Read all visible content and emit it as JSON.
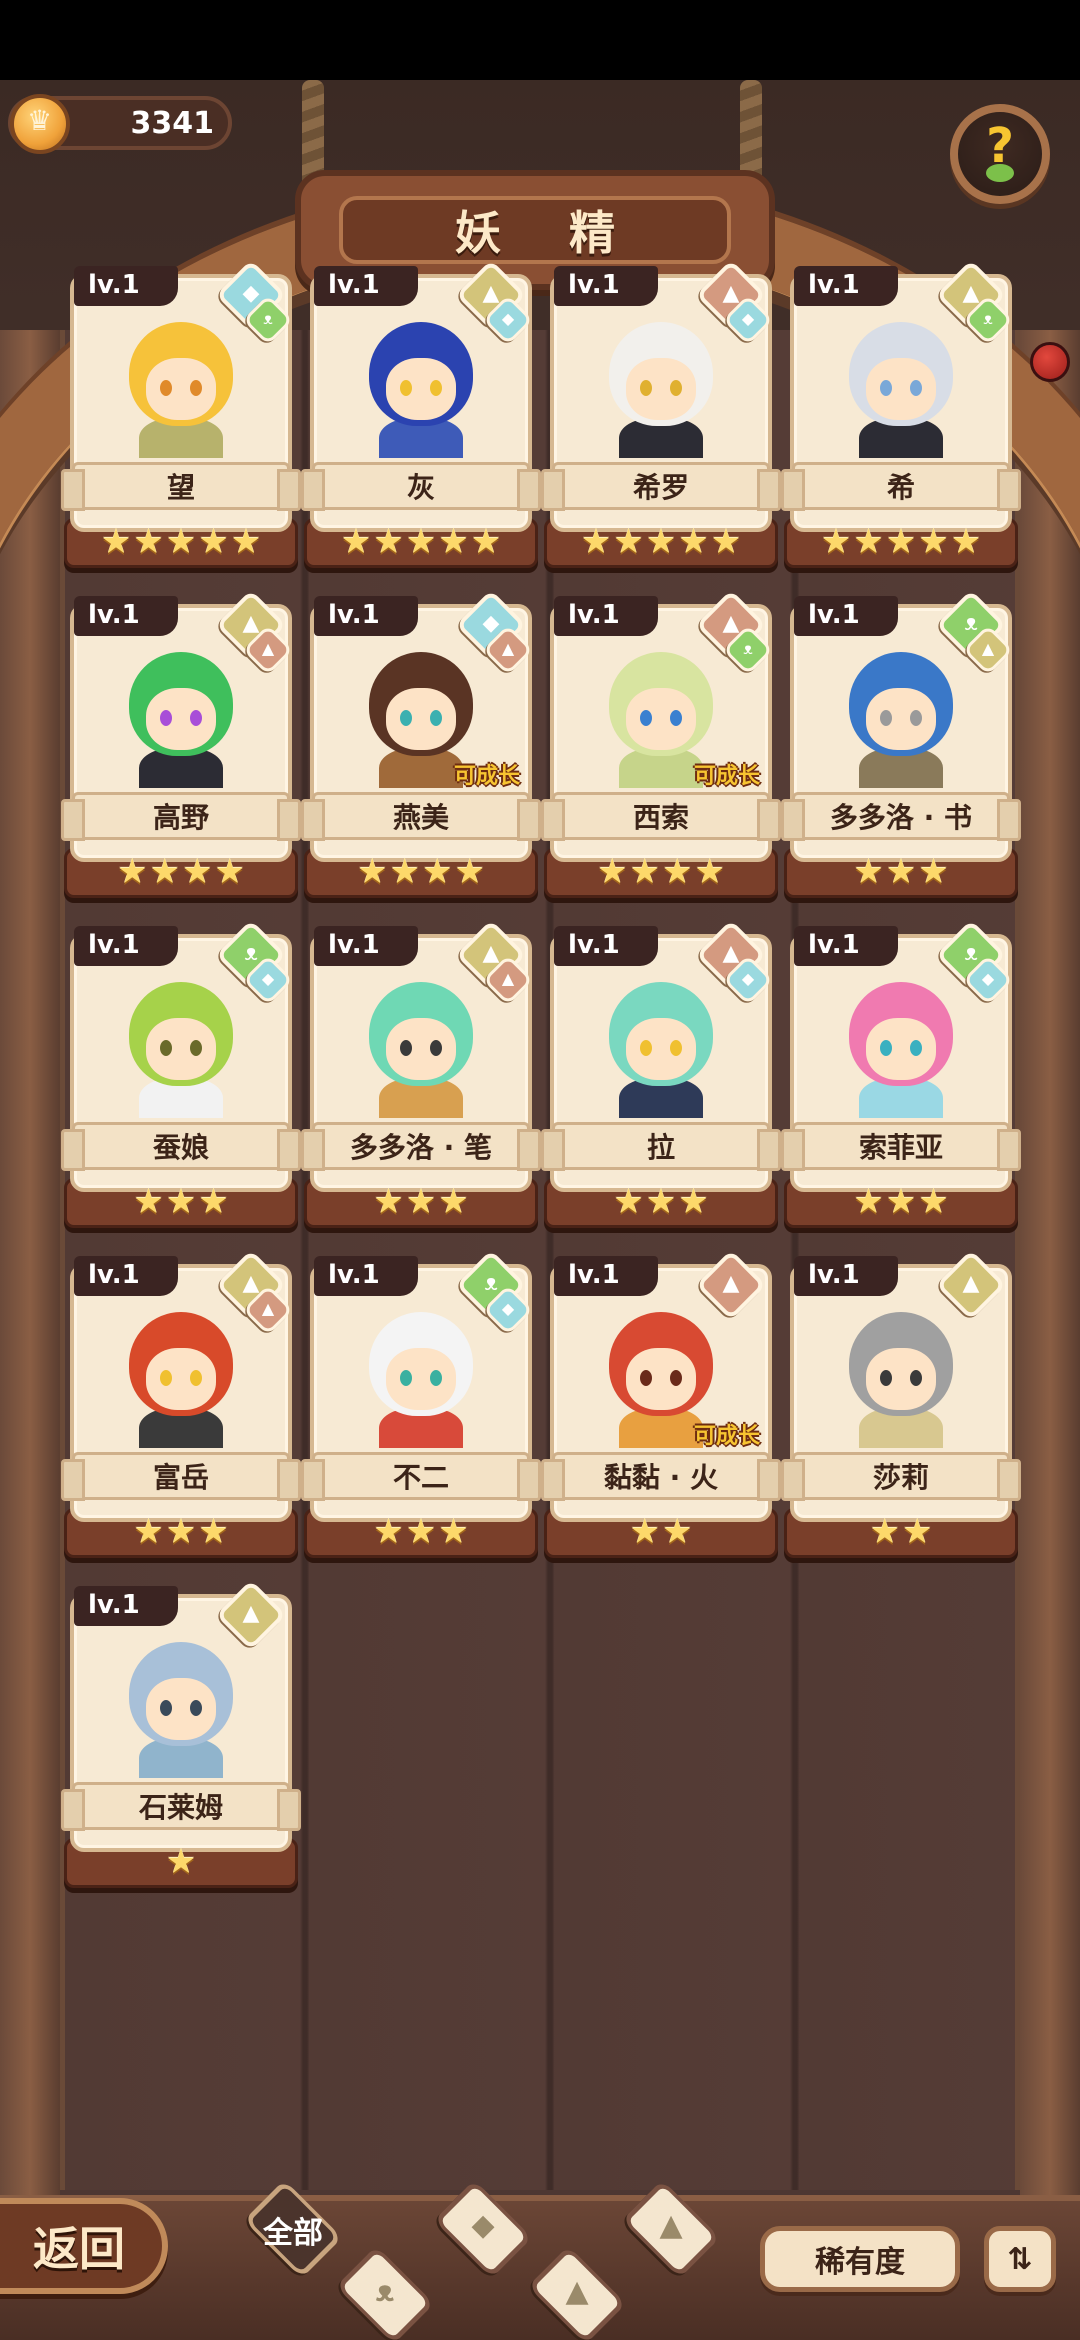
{
  "header": {
    "title": "妖 精",
    "currency_value": "3341"
  },
  "cards": [
    {
      "level": "lv.1",
      "name": "望",
      "stars": 5,
      "grow": "",
      "hair": "#f6c23a",
      "cloth": "#b7b26c",
      "eye": "#e08a2a",
      "elements": [
        "earth-wind",
        "grass"
      ]
    },
    {
      "level": "lv.1",
      "name": "灰",
      "stars": 5,
      "grow": "",
      "hair": "#2b43b0",
      "cloth": "#3e5bb8",
      "eye": "#f0c030",
      "elements": [
        "earth",
        "wind"
      ]
    },
    {
      "level": "lv.1",
      "name": "希罗",
      "stars": 5,
      "grow": "",
      "hair": "#f2f0ec",
      "cloth": "#2c2c34",
      "eye": "#e0b030",
      "elements": [
        "mountain",
        "wind"
      ]
    },
    {
      "level": "lv.1",
      "name": "希",
      "stars": 5,
      "grow": "",
      "hair": "#d8dde6",
      "cloth": "#2c2c34",
      "eye": "#7aa8d8",
      "elements": [
        "earth",
        "grass"
      ]
    },
    {
      "level": "lv.1",
      "name": "高野",
      "stars": 4,
      "grow": "",
      "hair": "#3fbf5c",
      "cloth": "#2c2c34",
      "eye": "#a84ed8",
      "elements": [
        "earth",
        "mountain"
      ]
    },
    {
      "level": "lv.1",
      "name": "燕美",
      "stars": 4,
      "grow": "可成长",
      "hair": "#5a3424",
      "cloth": "#a06a3a",
      "eye": "#3bb0b0",
      "elements": [
        "wind",
        "mountain"
      ]
    },
    {
      "level": "lv.1",
      "name": "西索",
      "stars": 4,
      "grow": "可成长",
      "hair": "#d8e4a0",
      "cloth": "#c6d48a",
      "eye": "#3a80d0",
      "elements": [
        "mountain",
        "grass"
      ]
    },
    {
      "level": "lv.1",
      "name": "多多洛 · 书",
      "stars": 3,
      "grow": "",
      "hair": "#3a78c8",
      "cloth": "#8a7a5a",
      "eye": "#9a9a9a",
      "elements": [
        "grass",
        "earth"
      ]
    },
    {
      "level": "lv.1",
      "name": "蚕娘",
      "stars": 3,
      "grow": "",
      "hair": "#a6d24a",
      "cloth": "#f2f2f2",
      "eye": "#6a6a2a",
      "elements": [
        "grass",
        "wind"
      ]
    },
    {
      "level": "lv.1",
      "name": "多多洛 · 笔",
      "stars": 3,
      "grow": "",
      "hair": "#6fd8b4",
      "cloth": "#d8a050",
      "eye": "#3a3a3a",
      "elements": [
        "earth",
        "mountain"
      ]
    },
    {
      "level": "lv.1",
      "name": "拉",
      "stars": 3,
      "grow": "",
      "hair": "#7ad8c0",
      "cloth": "#2e3a58",
      "eye": "#f0c030",
      "elements": [
        "mountain",
        "wind"
      ]
    },
    {
      "level": "lv.1",
      "name": "索菲亚",
      "stars": 3,
      "grow": "",
      "hair": "#f07ab0",
      "cloth": "#9ad8e4",
      "eye": "#3ab0c0",
      "elements": [
        "grass",
        "wind"
      ]
    },
    {
      "level": "lv.1",
      "name": "富岳",
      "stars": 3,
      "grow": "",
      "hair": "#d84a2a",
      "cloth": "#3a3a3a",
      "eye": "#f0c030",
      "elements": [
        "earth",
        "mountain"
      ]
    },
    {
      "level": "lv.1",
      "name": "不二",
      "stars": 3,
      "grow": "",
      "hair": "#f4f4f4",
      "cloth": "#d84a3a",
      "eye": "#3ab0a0",
      "elements": [
        "grass",
        "wind"
      ]
    },
    {
      "level": "lv.1",
      "name": "黏黏 · 火",
      "stars": 2,
      "grow": "可成长",
      "hair": "#d84a32",
      "cloth": "#e8a040",
      "eye": "#6a2a1a",
      "elements": [
        "mountain"
      ]
    },
    {
      "level": "lv.1",
      "name": "莎莉",
      "stars": 2,
      "grow": "",
      "hair": "#a0a0a0",
      "cloth": "#d8c890",
      "eye": "#3a3a3a",
      "elements": [
        "earth"
      ]
    },
    {
      "level": "lv.1",
      "name": "石莱姆",
      "stars": 1,
      "grow": "",
      "hair": "#a8c0d8",
      "cloth": "#90b4cc",
      "eye": "#3a4a5a",
      "elements": [
        "earth"
      ]
    }
  ],
  "footer": {
    "back_label": "返回",
    "filter_all_label": "全部",
    "sort_label": "稀有度",
    "order_icon": "sort-order-icon"
  },
  "colors": {
    "accent_gold": "#f7c531",
    "wood_dark": "#4a2e24",
    "paper": "#f7ead4"
  }
}
